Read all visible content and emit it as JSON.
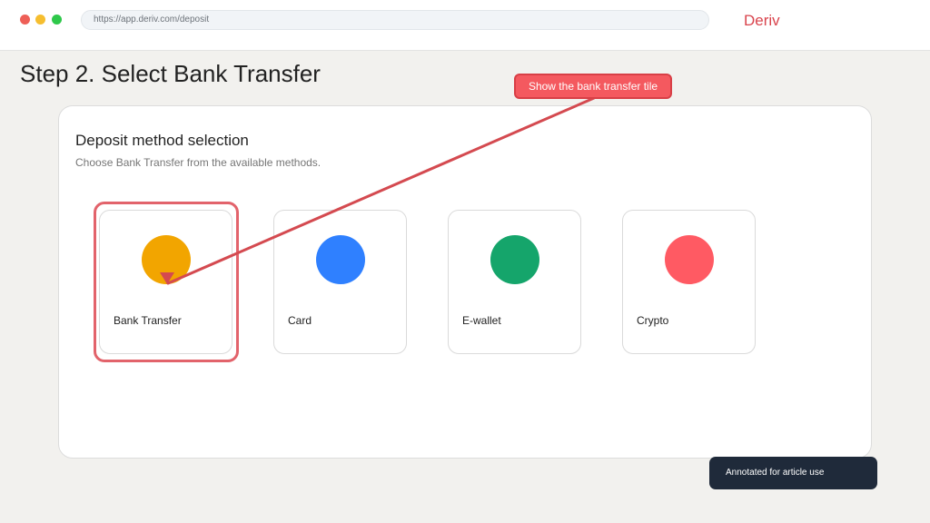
{
  "browser": {
    "url": "https://app.deriv.com/deposit",
    "brand": "Deriv"
  },
  "step_title": "Step 2. Select Bank Transfer",
  "panel": {
    "title": "Deposit method selection",
    "subtitle": "Choose Bank Transfer from the available methods."
  },
  "methods": [
    {
      "label": "Bank Transfer",
      "icon": "bank-transfer-icon",
      "color": "#f2a500"
    },
    {
      "label": "Card",
      "icon": "card-icon",
      "color": "#2f80ff"
    },
    {
      "label": "E-wallet",
      "icon": "e-wallet-icon",
      "color": "#15a56b"
    },
    {
      "label": "Crypto",
      "icon": "crypto-icon",
      "color": "#ff5a63"
    }
  ],
  "annotation": {
    "callout": "Show the bank transfer tile",
    "note": "Annotated for article use",
    "color": "#d44a50"
  }
}
